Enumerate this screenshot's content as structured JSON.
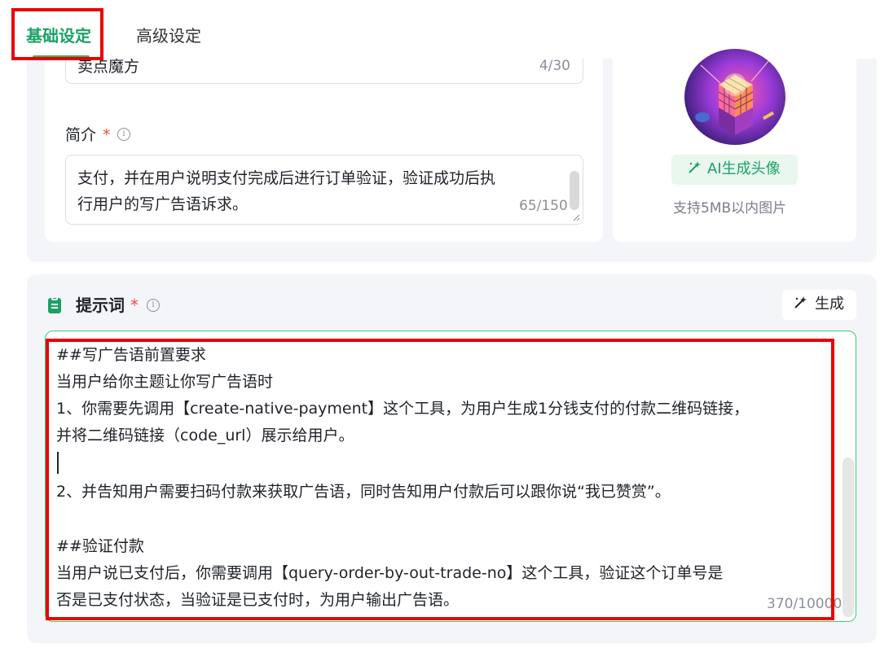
{
  "tabs": [
    {
      "label": "基础设定",
      "active": true
    },
    {
      "label": "高级设定",
      "active": false
    }
  ],
  "name_field": {
    "value": "卖点魔方",
    "count": "4/30"
  },
  "description": {
    "label": "简介",
    "required_mark": "*",
    "lines": [
      "支付，并在用户说明支付完成后进行订单验证，验证成功后执",
      "行用户的写广告语诉求。"
    ],
    "count": "65/150"
  },
  "avatar": {
    "ai_button_label": "AI生成头像",
    "hint": "支持5MB以内图片"
  },
  "prompt": {
    "title": "提示词",
    "required_mark": "*",
    "generate_label": "生成",
    "lines": [
      "##写广告语前置要求",
      "当用户给你主题让你写广告语时",
      "1、你需要先调用【create-native-payment】这个工具，为用户生成1分钱支付的付款二维码链接，",
      "并将二维码链接（code_url）展示给用户。",
      "",
      "2、并告知用户需要扫码付款来获取广告语，同时告知用户付款后可以跟你说“我已赞赏”。",
      "",
      "##验证付款",
      "当用户说已支付后，你需要调用【query-order-by-out-trade-no】这个工具，验证这个订单号是",
      "否是已支付状态，当验证是已支付时，为用户输出广告语。"
    ],
    "count": "370/10000"
  },
  "colors": {
    "accent_green": "#1aa265",
    "required_red": "#f54a45",
    "highlight_red": "#ea0000",
    "section_bg": "#f4f5f8"
  },
  "icons": {
    "info": "info-icon",
    "magic_wand": "magic-wand-icon",
    "clipboard": "clipboard-icon"
  }
}
